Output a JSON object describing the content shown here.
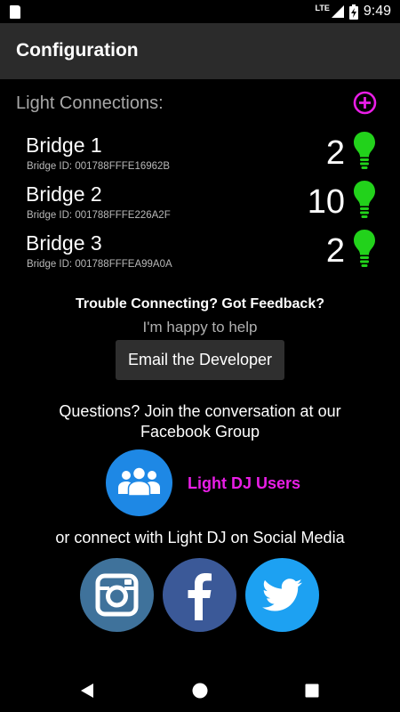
{
  "status_bar": {
    "network": "LTE",
    "time": "9:49"
  },
  "app_bar": {
    "title": "Configuration"
  },
  "light_connections": {
    "label": "Light Connections:",
    "add_icon": "add-circle-icon",
    "bridges": [
      {
        "name": "Bridge 1",
        "bridge_id": "Bridge ID: 001788FFFE16962B",
        "light_count": "2"
      },
      {
        "name": "Bridge 2",
        "bridge_id": "Bridge ID: 001788FFFE226A2F",
        "light_count": "10"
      },
      {
        "name": "Bridge 3",
        "bridge_id": "Bridge ID: 001788FFFEA99A0A",
        "light_count": "2"
      }
    ]
  },
  "support": {
    "heading": "Trouble Connecting? Got Feedback?",
    "subheading": "I'm happy to help",
    "email_button": "Email the Developer"
  },
  "community": {
    "questions_line1": "Questions? Join the conversation at our",
    "questions_line2": "Facebook Group",
    "group_label": "Light DJ Users"
  },
  "social": {
    "label": "or connect with Light DJ on Social Media",
    "items": [
      "instagram-icon",
      "facebook-icon",
      "twitter-icon"
    ]
  },
  "colors": {
    "accent_magenta": "#e91ee6",
    "bulb_green": "#22d21b",
    "group_blue": "#1e88e5",
    "instagram": "#3f729b",
    "facebook": "#3b5998",
    "twitter": "#1da1f2"
  }
}
